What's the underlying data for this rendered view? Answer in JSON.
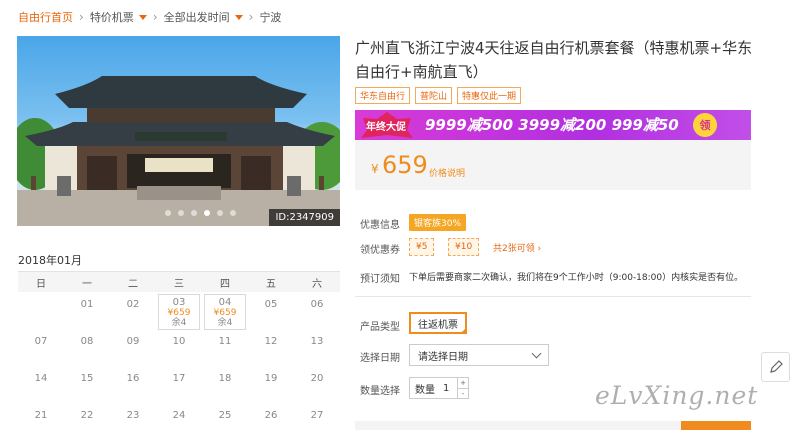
{
  "breadcrumb": {
    "home": "自由行首页",
    "flight": "特价机票",
    "time": "全部出发时间",
    "city": "宁波"
  },
  "photo": {
    "image_id": "ID:2347909"
  },
  "calendar": {
    "month": "2018年01月",
    "weekdays": [
      "日",
      "一",
      "二",
      "三",
      "四",
      "五",
      "六"
    ],
    "rows": [
      [
        {
          "d": ""
        },
        {
          "d": "01"
        },
        {
          "d": "02"
        },
        {
          "d": "03",
          "price": "¥659",
          "stock": "余4"
        },
        {
          "d": "04",
          "price": "¥659",
          "stock": "余4"
        },
        {
          "d": "05"
        },
        {
          "d": "06"
        }
      ],
      [
        {
          "d": "07"
        },
        {
          "d": "08"
        },
        {
          "d": "09"
        },
        {
          "d": "10"
        },
        {
          "d": "11"
        },
        {
          "d": "12"
        },
        {
          "d": "13"
        }
      ],
      [
        {
          "d": "14"
        },
        {
          "d": "15"
        },
        {
          "d": "16"
        },
        {
          "d": "17"
        },
        {
          "d": "18"
        },
        {
          "d": "19"
        },
        {
          "d": "20"
        }
      ],
      [
        {
          "d": "21"
        },
        {
          "d": "22"
        },
        {
          "d": "23"
        },
        {
          "d": "24"
        },
        {
          "d": "25"
        },
        {
          "d": "26"
        },
        {
          "d": "27"
        }
      ]
    ]
  },
  "product": {
    "title": "广州直飞浙江宁波4天往返自由行机票套餐（特惠机票+华东自由行+南航直飞）",
    "tags": [
      "华东自由行",
      "普陀山",
      "特惠仅此一期"
    ],
    "banner": {
      "label": "年终大促",
      "offers": "9999减500  3999减200  999减50",
      "button": "领"
    },
    "price": {
      "currency": "¥",
      "amount": "659",
      "explain": "价格说明"
    },
    "discount_label": "优惠信息",
    "discount_value": "银客族30%",
    "coupon_label": "领优惠券",
    "coupons": [
      "¥5",
      "¥10"
    ],
    "coupon_total": "共2张可领 ›",
    "notice_label": "预订须知",
    "notice_text": "下单后需要商家二次确认，我们将在9个工作小时（9:00-18:00）内核实是否有位。",
    "type_label": "产品类型",
    "type_value": "往返机票",
    "date_label": "选择日期",
    "date_value": "请选择日期",
    "qty_label": "数量选择",
    "qty_text": "数量",
    "qty_value": "1",
    "qty_plus": "+",
    "qty_minus": "-"
  },
  "watermark": "eLvXing.net",
  "colors": {
    "accent": "#f08c1e",
    "banner": "#c03ad9"
  }
}
